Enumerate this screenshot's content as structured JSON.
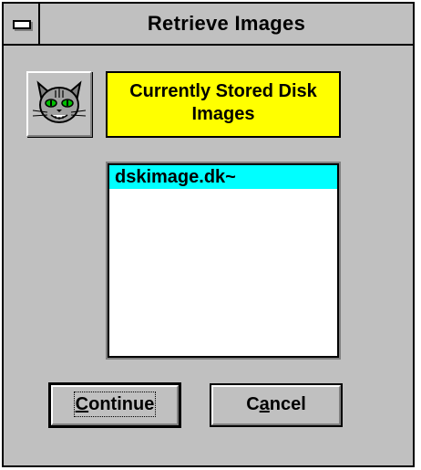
{
  "window": {
    "title": "Retrieve Images"
  },
  "icons": {
    "system_menu": "system-menu-icon",
    "cat": "cat-icon"
  },
  "header": {
    "label_line1": "Currently Stored Disk",
    "label_line2": "Images"
  },
  "list": {
    "items": [
      {
        "label": "dskimage.dk~",
        "selected": true
      }
    ]
  },
  "buttons": {
    "continue": {
      "prefix": "",
      "mnemonic": "C",
      "rest": "ontinue"
    },
    "cancel": {
      "prefix": "C",
      "mnemonic": "a",
      "rest": "ncel"
    }
  },
  "colors": {
    "window_bg": "#c0c0c0",
    "header_bg": "#ffff00",
    "selection_bg": "#00ffff"
  }
}
